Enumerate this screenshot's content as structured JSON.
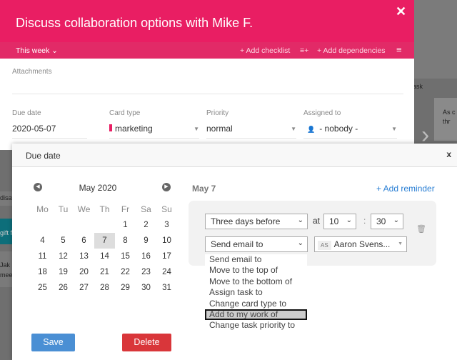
{
  "card": {
    "title": "Discuss collaboration options with Mike F.",
    "close": "✕",
    "week": "This week ⌄",
    "add_checklist": "+ Add checklist",
    "list_icon": "≡+",
    "add_dependencies": "+ Add dependencies",
    "menu_icon": "≡",
    "attachments": "Attachments",
    "fields": {
      "due_label": "Due date",
      "due_value": "2020-05-07",
      "type_label": "Card type",
      "type_value": "marketing",
      "type_color": "#e91e63",
      "priority_label": "Priority",
      "priority_value": "normal",
      "assigned_label": "Assigned to",
      "assigned_value": "- nobody -"
    }
  },
  "background": {
    "t1": "ask",
    "t2": "As c",
    "t3": "thr",
    "t4": "disav",
    "t5": "gift f",
    "t6": "Jak",
    "t7": "mee"
  },
  "popup": {
    "title": "Due date",
    "close": "x",
    "month": "May 2020",
    "weekdays": [
      "Mo",
      "Tu",
      "We",
      "Th",
      "Fr",
      "Sa",
      "Su"
    ],
    "days": [
      "",
      "",
      "",
      "",
      "1",
      "2",
      "3",
      "4",
      "5",
      "6",
      "7",
      "8",
      "9",
      "10",
      "11",
      "12",
      "13",
      "14",
      "15",
      "16",
      "17",
      "18",
      "19",
      "20",
      "21",
      "22",
      "23",
      "24",
      "25",
      "26",
      "27",
      "28",
      "29",
      "30",
      "31"
    ],
    "selected_day": "7",
    "selected_date": "May 7",
    "add_reminder": "+ Add reminder",
    "save": "Save",
    "delete": "Delete",
    "reminder": {
      "when": "Three days before",
      "at": "at",
      "hour": "10",
      "colon": ":",
      "minute": "30",
      "action": "Send email to",
      "assignee_initials": "AS",
      "assignee": "Aaron Svens...",
      "options": [
        "Send email to",
        "Move to the top of",
        "Move to the bottom of",
        "Assign task to",
        "Change card type to",
        "Add to my work of",
        "Change task priority to"
      ],
      "highlighted": "Add to my work of"
    }
  },
  "colors": {
    "header": "#e91e63",
    "save": "#4a8fd4",
    "delete": "#d9363a",
    "link": "#2a7fd4"
  }
}
